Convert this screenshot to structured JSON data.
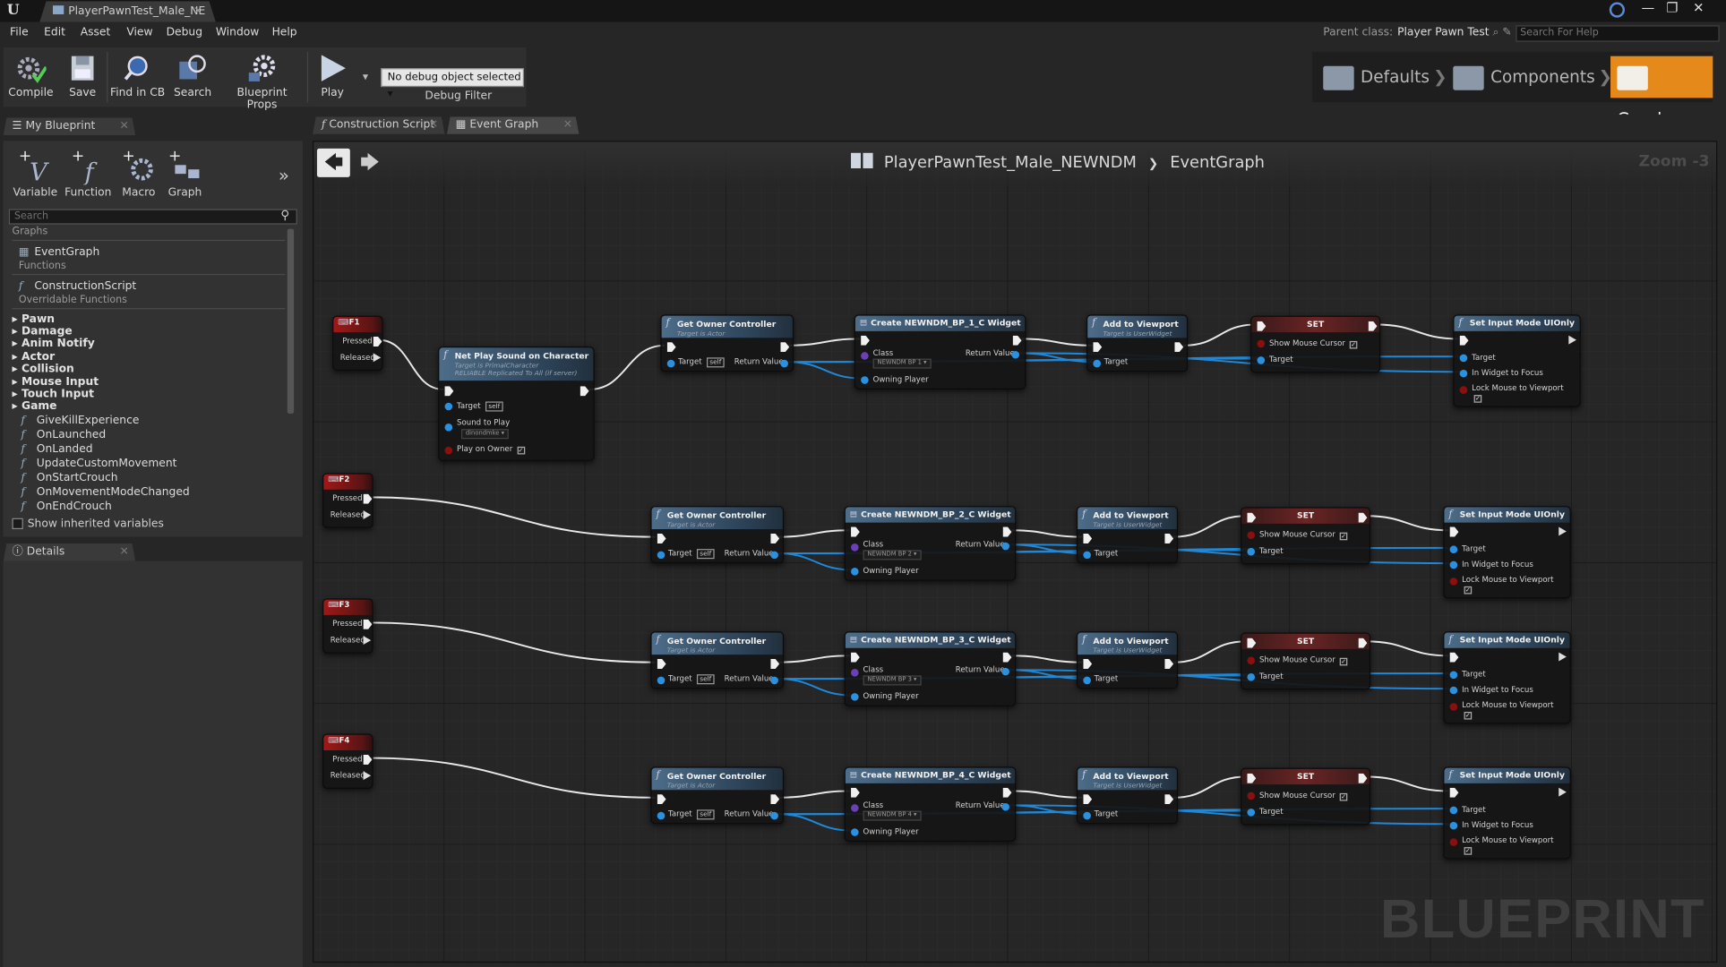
{
  "window": {
    "tab_title": "PlayerPawnTest_Male_NE",
    "minimize": "—",
    "restore": "❐",
    "close": "✕",
    "logo": "U"
  },
  "menu": [
    "File",
    "Edit",
    "Asset",
    "View",
    "Debug",
    "Window",
    "Help"
  ],
  "parent_class": {
    "label": "Parent class:",
    "value": "Player Pawn Test"
  },
  "help_search": {
    "placeholder": "Search For Help"
  },
  "toolbar": {
    "compile": "Compile",
    "save": "Save",
    "find_in_cb": "Find in CB",
    "search": "Search",
    "blueprint_props": "Blueprint Props",
    "play": "Play",
    "debug_object": "No debug object selected ▾",
    "debug_filter": "Debug Filter"
  },
  "modes": {
    "defaults": "Defaults",
    "components": "Components",
    "graph": "Graph",
    "active": "Graph"
  },
  "my_blueprint": {
    "tab": "My Blueprint",
    "add_buttons": {
      "variable": "Variable",
      "function": "Function",
      "macro": "Macro",
      "graph": "Graph"
    },
    "search_placeholder": "Search",
    "sections": {
      "graphs": "Graphs",
      "event_graph": "EventGraph",
      "functions": "Functions",
      "construction_script": "ConstructionScript",
      "overridable": "Overridable Functions"
    },
    "categories": [
      "Pawn",
      "Damage",
      "Anim Notify",
      "Actor",
      "Collision",
      "Mouse Input",
      "Touch Input",
      "Game"
    ],
    "overridable_items": [
      "GiveKillExperience",
      "OnLaunched",
      "OnLanded",
      "UpdateCustomMovement",
      "OnStartCrouch",
      "OnMovementModeChanged",
      "OnEndCrouch"
    ],
    "show_inherited": "Show inherited variables"
  },
  "details": {
    "tab": "Details"
  },
  "graph_tabs": {
    "construction": "Construction Script",
    "event_graph": "Event Graph"
  },
  "graph": {
    "breadcrumb_bp": "PlayerPawnTest_Male_NEWNDM",
    "breadcrumb_sep": "❯",
    "breadcrumb_graph": "EventGraph",
    "zoom": "Zoom -3",
    "watermark": "BLUEPRINT"
  },
  "common": {
    "pressed": "Pressed",
    "released": "Released",
    "get_owner_controller": "Get Owner Controller",
    "target_is_actor": "Target is Actor",
    "target": "Target",
    "self": "self",
    "return_value": "Return Value",
    "class": "Class",
    "owning_player": "Owning Player",
    "add_to_viewport": "Add to Viewport",
    "target_is_user_widget": "Target is UserWidget",
    "set": "SET",
    "show_mouse_cursor": "Show Mouse Cursor",
    "set_input_mode": "Set Input Mode UIOnly",
    "in_widget_to_focus": "In Widget to Focus",
    "lock_mouse": "Lock Mouse to Viewport",
    "check": "✓"
  },
  "net_play_sound": {
    "title": "Net Play Sound on Character",
    "sub1": "Target is PrimalCharacter",
    "sub2": "RELIABLE Replicated To All (if server)",
    "target": "Target",
    "self": "self",
    "sound_to_play": "Sound to Play",
    "sound_value": "dinondmke ▾",
    "play_on_owner": "Play on Owner"
  },
  "rows": [
    {
      "key": "F1",
      "widget": "Create NEWNDM_BP_1_C Widget",
      "class_value": "NEWNDM BP 1 ▾"
    },
    {
      "key": "F2",
      "widget": "Create NEWNDM_BP_2_C Widget",
      "class_value": "NEWNDM BP 2 ▾"
    },
    {
      "key": "F3",
      "widget": "Create NEWNDM_BP_3_C Widget",
      "class_value": "NEWNDM BP 3 ▾"
    },
    {
      "key": "F4",
      "widget": "Create NEWNDM_BP_4_C Widget",
      "class_value": "NEWNDM BP 4 ▾"
    }
  ],
  "colors": {
    "accent": "#e5891a",
    "object_pin": "#2a90e0",
    "exec_pin": "#f0f0f0",
    "event_header": "#a01818",
    "function_header": "#4d6d8a"
  }
}
